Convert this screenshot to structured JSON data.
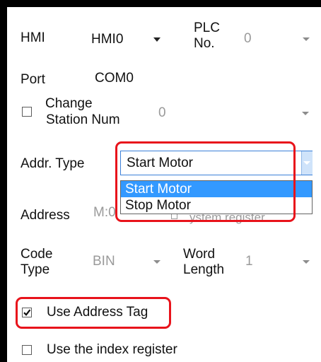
{
  "hmi": {
    "label": "HMI",
    "value": "HMI0"
  },
  "plc": {
    "label_line1": "PLC",
    "label_line2": "No.",
    "value": "0"
  },
  "port": {
    "label": "Port",
    "value": "COM0"
  },
  "change_station": {
    "label_line1": "Change",
    "label_line2": "Station Num",
    "value": "0",
    "checked": false
  },
  "addr_type": {
    "label": "Addr. Type",
    "value": "Start Motor",
    "options": [
      "Start Motor",
      "Stop Motor"
    ],
    "selected_index": 0
  },
  "address": {
    "label": "Address",
    "value_partial": "M:0",
    "hidden_text_partial": "ystem register"
  },
  "code_type": {
    "label_line1": "Code",
    "label_line2": "Type",
    "value": "BIN"
  },
  "word_length": {
    "label_line1": "Word",
    "label_line2": "Length",
    "value": "1"
  },
  "use_address_tag": {
    "label": "Use Address Tag",
    "checked": true
  },
  "use_index_register": {
    "label": "Use the index register",
    "checked": false
  },
  "colors": {
    "highlight_red": "#e8131b",
    "selection_blue": "#3399ff",
    "dropdown_border": "#3b80d8"
  }
}
